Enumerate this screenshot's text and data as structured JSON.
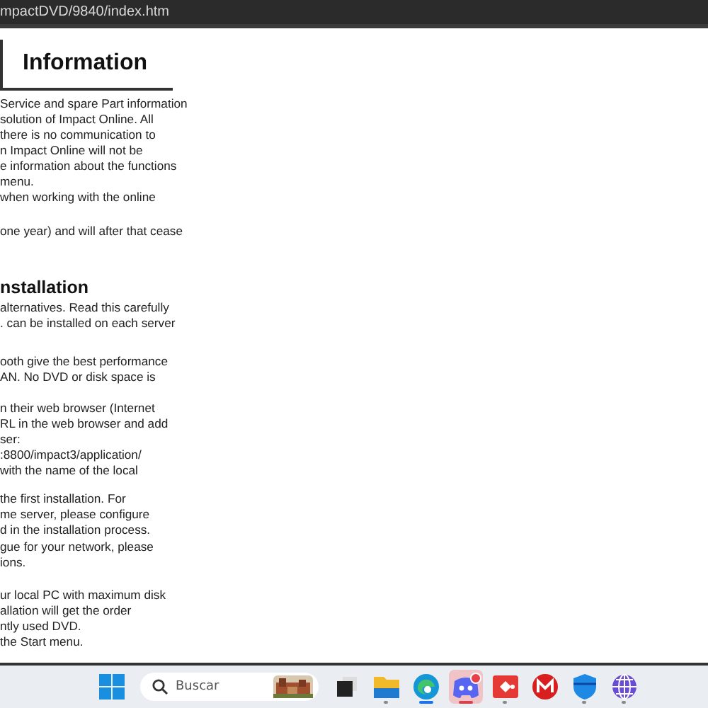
{
  "address_bar": {
    "url": "mpactDVD/9840/index.htm"
  },
  "document": {
    "title": "Information",
    "sections": [
      {
        "paragraphs": [
          [
            "Service and spare Part information",
            "solution of Impact Online. All",
            "there is no communication to",
            "n Impact Online will not be",
            "e information about the functions",
            "menu."
          ],
          [
            "when working with the online"
          ],
          [
            "one year) and will after that cease"
          ]
        ]
      },
      {
        "heading": "nstallation",
        "paragraphs": [
          [
            "alternatives. Read this carefully",
            ". can be installed on each server"
          ],
          [
            "ooth give the best performance",
            "AN. No DVD or disk space is"
          ],
          [
            "n their web browser (Internet",
            "RL in the web browser and add",
            "ser:",
            ":8800/impact3/application/",
            "with the name of the local"
          ],
          [
            "the first installation. For",
            "me server, please configure",
            "d in the installation process."
          ],
          [
            "gue for your network, please",
            "ions."
          ],
          [
            "ur local PC with maximum disk",
            "allation will get the order",
            "ntly used DVD."
          ],
          [
            "the Start menu."
          ]
        ]
      }
    ]
  },
  "taskbar": {
    "search": {
      "placeholder": "Buscar"
    },
    "apps": [
      {
        "kind": "start",
        "selected": false,
        "running": false
      },
      {
        "kind": "taskview",
        "selected": false,
        "running": false
      },
      {
        "kind": "folder",
        "selected": false,
        "running": true
      },
      {
        "kind": "browser",
        "selected": false,
        "running": true
      },
      {
        "kind": "chat",
        "selected": true,
        "running": true
      },
      {
        "kind": "remote",
        "selected": false,
        "running": true
      },
      {
        "kind": "mail",
        "selected": false,
        "running": false
      },
      {
        "kind": "shield",
        "selected": false,
        "running": true
      },
      {
        "kind": "globe",
        "selected": false,
        "running": true
      }
    ]
  }
}
